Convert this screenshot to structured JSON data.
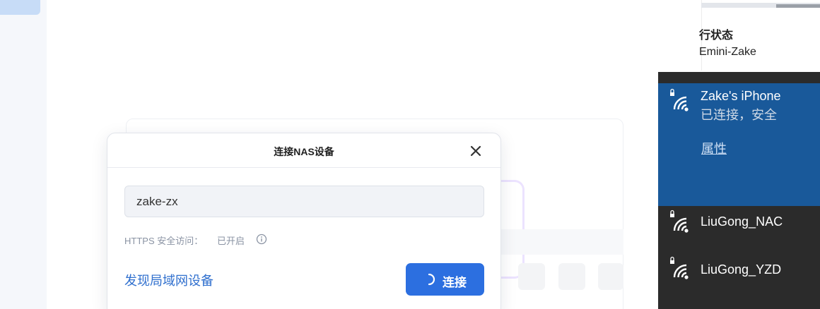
{
  "background": {
    "right_panel": {
      "heading": "行状态",
      "device": "Emini-Zake"
    }
  },
  "dialog": {
    "title": "连接NAS设备",
    "close_icon": "close-icon",
    "input": {
      "value": "zake-zx",
      "placeholder": ""
    },
    "https_label": "HTTPS 安全访问：",
    "https_value": "已开启",
    "info_icon": "info-icon",
    "discover_link": "发现局域网设备",
    "connect_button": "连接",
    "spinner_icon": "spinner-icon"
  },
  "wifi": {
    "networks": [
      {
        "name": "Zake's iPhone",
        "status": "已连接，安全",
        "action": "属性",
        "selected": true,
        "icon": "wifi-secured-icon"
      },
      {
        "name": "LiuGong_NAC",
        "icon": "wifi-secured-icon"
      },
      {
        "name": "LiuGong_YZD",
        "icon": "wifi-secured-icon"
      }
    ]
  },
  "colors": {
    "accent": "#2c6fe0",
    "link": "#2f6fce",
    "wifi_selected": "#19599a",
    "wifi_panel": "#2b2b2b"
  }
}
